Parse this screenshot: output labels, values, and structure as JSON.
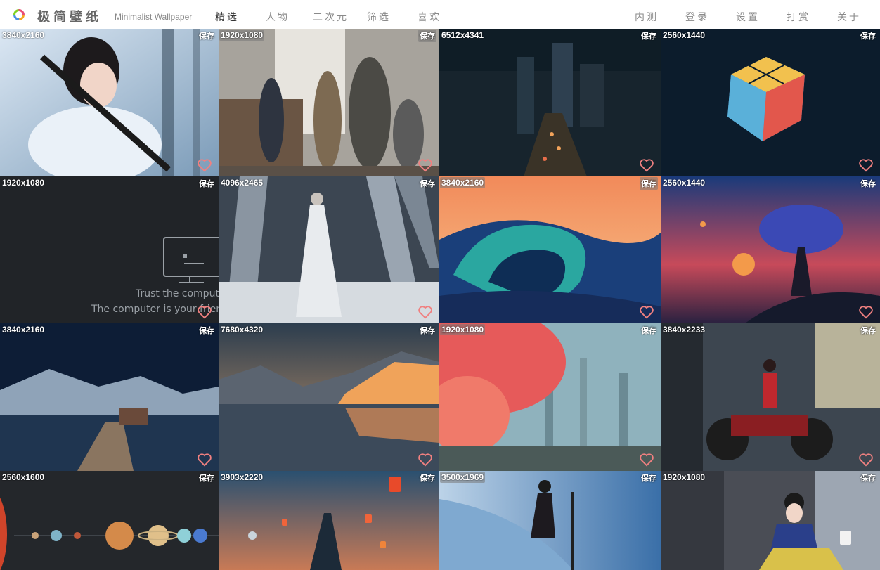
{
  "header": {
    "brand": "极简壁纸",
    "brand_sub": "Minimalist Wallpaper",
    "nav_left": [
      "精选",
      "人物",
      "二次元",
      "筛选",
      "喜欢"
    ],
    "nav_right": [
      "内测",
      "登录",
      "设置",
      "打赏",
      "关于"
    ],
    "active_nav": "精选"
  },
  "tile_action": "保存",
  "tiles": [
    {
      "resolution": "3840x2160",
      "subject": "girl-with-sword"
    },
    {
      "resolution": "1920x1080",
      "subject": "bank-robbery"
    },
    {
      "resolution": "6512x4341",
      "subject": "night-city"
    },
    {
      "resolution": "2560x1440",
      "subject": "rubiks-cube"
    },
    {
      "resolution": "1920x1080",
      "subject": "computer-message",
      "caption_1": "Trust the computer",
      "caption_2": "The computer is your friend"
    },
    {
      "resolution": "4096x2465",
      "subject": "columns-figure"
    },
    {
      "resolution": "3840x2160",
      "subject": "ocean-wave"
    },
    {
      "resolution": "2560x1440",
      "subject": "sunset-tree"
    },
    {
      "resolution": "3840x2160",
      "subject": "lake-pier"
    },
    {
      "resolution": "7680x4320",
      "subject": "mountain-lake"
    },
    {
      "resolution": "1920x1080",
      "subject": "red-forest"
    },
    {
      "resolution": "3840x2233",
      "subject": "motorcycle-girl"
    },
    {
      "resolution": "2560x1600",
      "subject": "solar-system"
    },
    {
      "resolution": "3903x2220",
      "subject": "lanterns"
    },
    {
      "resolution": "3500x1969",
      "subject": "singer"
    },
    {
      "resolution": "1920x1080",
      "subject": "snow-white"
    }
  ],
  "colors": {
    "heart": "#f08080",
    "monitor": "#9aa0a6"
  }
}
